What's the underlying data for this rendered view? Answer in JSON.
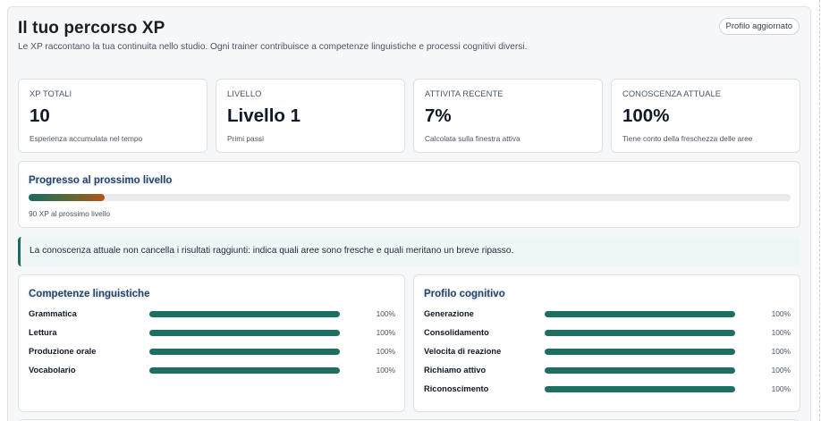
{
  "header": {
    "title": "Il tuo percorso XP",
    "subtitle": "Le XP raccontano la tua continuita nello studio. Ogni trainer contribuisce a competenze linguistiche e processi cognitivi diversi.",
    "badge": "Profilo aggiornato"
  },
  "stats": [
    {
      "label": "XP TOTALI",
      "value": "10",
      "note": "Esperienza accumulata nel tempo"
    },
    {
      "label": "LIVELLO",
      "value": "Livello 1",
      "note": "Primi passi"
    },
    {
      "label": "ATTIVITA RECENTE",
      "value": "7%",
      "note": "Calcolata sulla finestra attiva"
    },
    {
      "label": "CONOSCENZA ATTUALE",
      "value": "100%",
      "note": "Tiene conto della freschezza delle aree"
    }
  ],
  "progress": {
    "title": "Progresso al prossimo livello",
    "fraction": 0.1,
    "note": "90 XP al prossimo livello"
  },
  "callout": "La conoscenza attuale non cancella i risultati raggiunti: indica quali aree sono fresche e quali meritano un breve ripasso.",
  "linguistic": {
    "title": "Competenze linguistiche",
    "items": [
      {
        "name": "Grammatica",
        "value": 100,
        "label": "100%"
      },
      {
        "name": "Lettura",
        "value": 100,
        "label": "100%"
      },
      {
        "name": "Produzione orale",
        "value": 100,
        "label": "100%"
      },
      {
        "name": "Vocabolario",
        "value": 100,
        "label": "100%"
      }
    ]
  },
  "cognitive": {
    "title": "Profilo cognitivo",
    "items": [
      {
        "name": "Generazione",
        "value": 100,
        "label": "100%"
      },
      {
        "name": "Consolidamento",
        "value": 100,
        "label": "100%"
      },
      {
        "name": "Velocita di reazione",
        "value": 100,
        "label": "100%"
      },
      {
        "name": "Richiamo attivo",
        "value": 100,
        "label": "100%"
      },
      {
        "name": "Riconoscimento",
        "value": 100,
        "label": "100%"
      }
    ]
  }
}
